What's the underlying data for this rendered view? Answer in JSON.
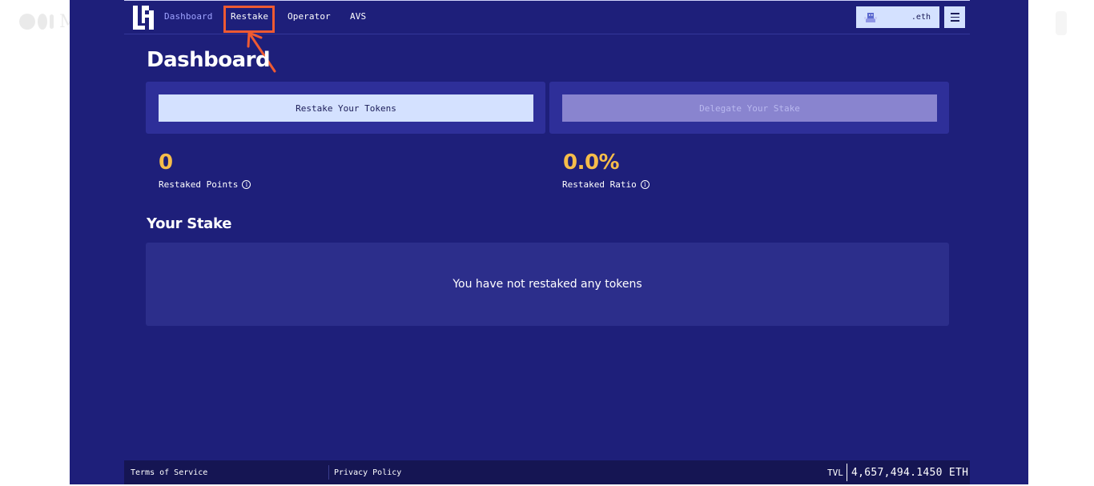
{
  "nav": {
    "items": [
      {
        "label": "Dashboard"
      },
      {
        "label": "Restake"
      },
      {
        "label": "Operator"
      },
      {
        "label": "AVS"
      }
    ],
    "active_index": 0,
    "highlighted_index": 1,
    "wallet_label": ".eth"
  },
  "main": {
    "page_title": "Dashboard",
    "restake_button": "Restake Your Tokens",
    "delegate_button": "Delegate Your Stake",
    "stats": [
      {
        "value": "0",
        "label": "Restaked Points"
      },
      {
        "value": "0.0%",
        "label": "Restaked Ratio"
      }
    ],
    "stake_section_title": "Your Stake",
    "empty_stake_message": "You have not restaked any tokens"
  },
  "footer": {
    "terms": "Terms of Service",
    "privacy": "Privacy Policy",
    "tvl_label": "TVL",
    "tvl_value": "4,657,494.1450 ETH"
  },
  "colors": {
    "background": "#1e1f7a",
    "panel": "#2e2f99",
    "primary_button": "#d4e1ff",
    "secondary_button": "#8984cf",
    "stat_value": "#f6bd4a",
    "annotation": "#ee5a32",
    "footer": "#151553"
  },
  "icons": {
    "logo": "eigenlayer-logo",
    "wallet_avatar": "avatar-icon",
    "menu": "hamburger-menu-icon",
    "info": "info-icon",
    "annotation_arrow": "arrow-icon"
  }
}
